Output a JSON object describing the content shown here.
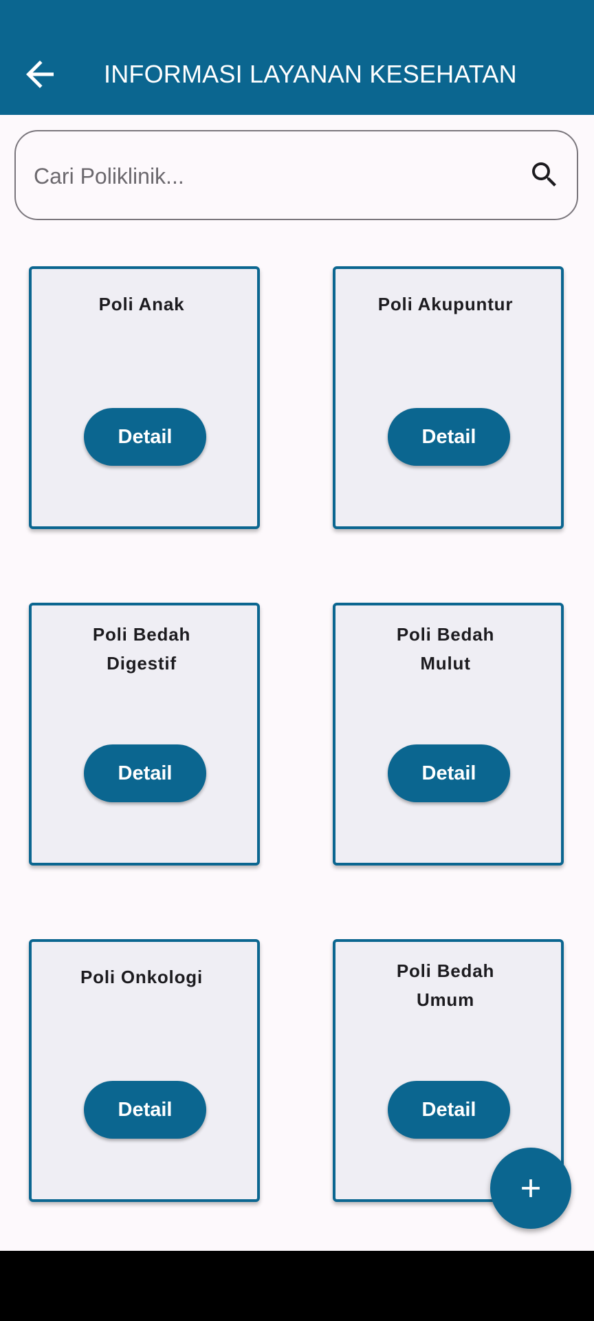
{
  "appbar": {
    "title": "INFORMASI LAYANAN KESEHATAN",
    "back_icon": "arrow-left-icon"
  },
  "search": {
    "placeholder": "Cari Poliklinik...",
    "value": "",
    "icon": "search-icon"
  },
  "cards": [
    {
      "title": "Poli Anak",
      "button_label": "Detail"
    },
    {
      "title": "Poli Akupuntur",
      "button_label": "Detail"
    },
    {
      "title": "Poli Bedah Digestif",
      "button_label": "Detail"
    },
    {
      "title": "Poli Bedah Mulut",
      "button_label": "Detail"
    },
    {
      "title": "Poli Onkologi",
      "button_label": "Detail"
    },
    {
      "title": "Poli Bedah Umum",
      "button_label": "Detail"
    }
  ],
  "fab": {
    "icon": "plus-icon"
  },
  "colors": {
    "primary": "#0b6690",
    "card_background": "#efeef4",
    "page_background": "#fdf9fc"
  }
}
